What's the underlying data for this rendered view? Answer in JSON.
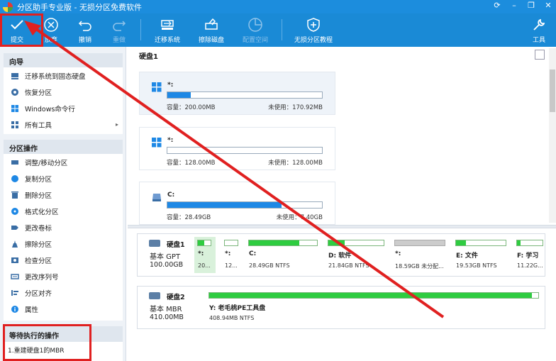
{
  "app": {
    "title": "分区助手专业版 - 无损分区免费软件"
  },
  "toolbar": {
    "items": [
      {
        "label": "提交",
        "icon": "check-icon",
        "disabled": false
      },
      {
        "label": "放弃",
        "icon": "discard-icon",
        "disabled": false
      },
      {
        "label": "撤销",
        "icon": "undo-icon",
        "disabled": false
      },
      {
        "label": "重做",
        "icon": "redo-icon",
        "disabled": true
      },
      {
        "label": "迁移系统",
        "icon": "migrate-system-icon",
        "disabled": false
      },
      {
        "label": "擦除磁盘",
        "icon": "wipe-disk-icon",
        "disabled": false
      },
      {
        "label": "配置空间",
        "icon": "allocate-space-icon",
        "disabled": true
      },
      {
        "label": "无损分区教程",
        "icon": "tutorial-icon",
        "disabled": false
      },
      {
        "label": "工具",
        "icon": "tools-icon",
        "disabled": false
      }
    ]
  },
  "sidebar": {
    "wizard_title": "向导",
    "wizard_items": [
      {
        "label": "迁移系统到固态硬盘",
        "icon": "ssd-icon"
      },
      {
        "label": "恢复分区",
        "icon": "recover-icon"
      },
      {
        "label": "Windows命令行",
        "icon": "windows-icon"
      },
      {
        "label": "所有工具",
        "icon": "grid-icon",
        "has_submenu": true
      }
    ],
    "ops_title": "分区操作",
    "ops_items": [
      {
        "label": "调整/移动分区",
        "icon": "resize-icon"
      },
      {
        "label": "复制分区",
        "icon": "copy-icon"
      },
      {
        "label": "删除分区",
        "icon": "delete-icon"
      },
      {
        "label": "格式化分区",
        "icon": "format-icon"
      },
      {
        "label": "更改卷标",
        "icon": "label-icon"
      },
      {
        "label": "擦除分区",
        "icon": "wipe-icon"
      },
      {
        "label": "检查分区",
        "icon": "check-partition-icon"
      },
      {
        "label": "更改序列号",
        "icon": "serial-icon"
      },
      {
        "label": "分区对齐",
        "icon": "align-icon"
      },
      {
        "label": "属性",
        "icon": "info-icon"
      }
    ],
    "pending_title": "等待执行的操作",
    "pending_items": [
      "1.重建硬盘1的MBR"
    ]
  },
  "disk_view": {
    "title": "硬盘1",
    "partitions": [
      {
        "name": "*:",
        "os_icon": "windows-icon",
        "capacity_label": "容量：200.00MB",
        "unused_label": "未使用：170.92MB",
        "used_fraction": 0.15
      },
      {
        "name": "*:",
        "os_icon": "windows-icon",
        "capacity_label": "容量：128.00MB",
        "unused_label": "未使用：128.00MB",
        "used_fraction": 0.0
      },
      {
        "name": "C:",
        "os_icon": "drive-icon",
        "capacity_label": "容量：28.49GB",
        "unused_label": "未使用：7.40GB",
        "used_fraction": 0.74
      }
    ]
  },
  "disk_map": {
    "disks": [
      {
        "name": "硬盘1",
        "type": "基本 GPT",
        "size": "100.00GB",
        "partitions": [
          {
            "label": "*:",
            "info": "20...",
            "used_fraction": 0.5,
            "selected": true
          },
          {
            "label": "*:",
            "info": "12...",
            "used_fraction": 0.0
          },
          {
            "label": "C:",
            "info": "28.49GB NTFS",
            "used_fraction": 0.74
          },
          {
            "label": "D: 软件",
            "info": "21.84GB NTFS",
            "used_fraction": 0.3
          },
          {
            "label": "*:",
            "info": "18.59GB 未分配...",
            "used_fraction": 1.0,
            "unallocated": true
          },
          {
            "label": "E: 文件",
            "info": "19.53GB NTFS",
            "used_fraction": 0.2
          },
          {
            "label": "F: 学习",
            "info": "11.22G...",
            "used_fraction": 0.15
          }
        ]
      },
      {
        "name": "硬盘2",
        "type": "基本 MBR",
        "size": "410.00MB",
        "partitions": [
          {
            "label": "Y: 老毛桃PE工具盘",
            "info": "408.94MB NTFS",
            "used_fraction": 0.98
          }
        ]
      }
    ]
  },
  "colors": {
    "titlebar": "#1c8ddd",
    "toolbar": "#1a8ad6",
    "annotation": "#e02020",
    "used_bar": "#1e88e5",
    "map_bar": "#2ecc40"
  }
}
